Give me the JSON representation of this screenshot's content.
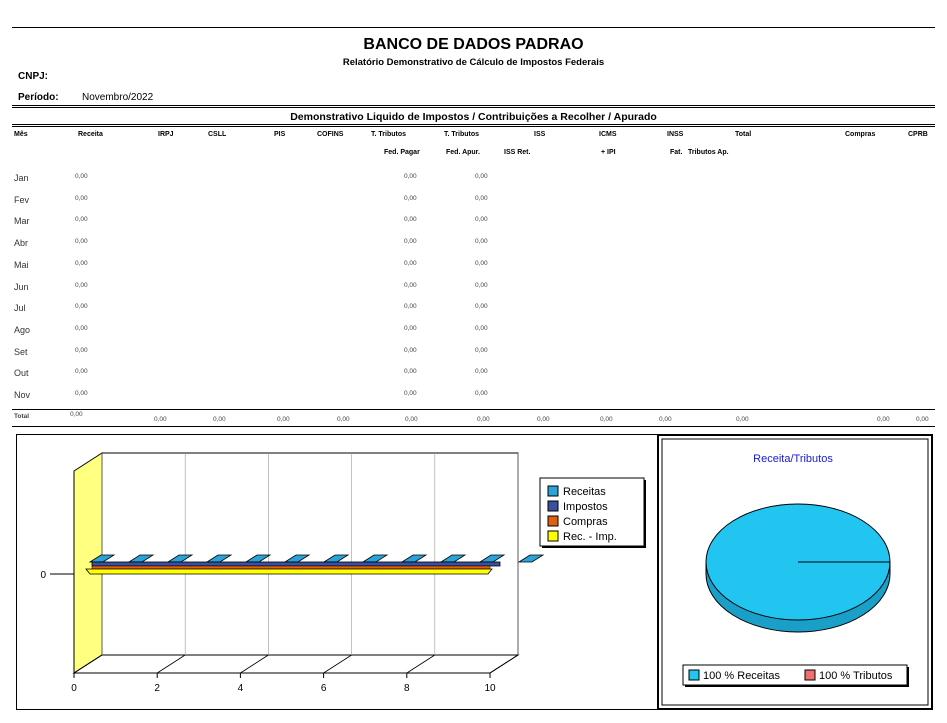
{
  "header": {
    "title": "BANCO DE DADOS PADRAO",
    "subtitle": "Relatório Demonstrativo de Cálculo de Impostos Federais",
    "cnpj_label": "CNPJ:",
    "cnpj_value": "",
    "periodo_label": "Período:",
    "periodo_value": "Novembro/2022"
  },
  "section_title": "Demonstrativo Liquido de Impostos / Contribuições a Recolher  / Apurado",
  "columns": [
    {
      "line1": "Mês",
      "line2": ""
    },
    {
      "line1": "Receita",
      "line2": ""
    },
    {
      "line1": "IRPJ",
      "line2": ""
    },
    {
      "line1": "CSLL",
      "line2": ""
    },
    {
      "line1": "PIS",
      "line2": ""
    },
    {
      "line1": "COFINS",
      "line2": ""
    },
    {
      "line1": "T. Tributos",
      "line2": "Fed. Pagar"
    },
    {
      "line1": "T. Tributos",
      "line2": "Fed. Apur."
    },
    {
      "line1": "ISS",
      "line2": "ISS Ret."
    },
    {
      "line1": "ICMS",
      "line2": "+ IPI"
    },
    {
      "line1": "INSS",
      "line2": "Fat."
    },
    {
      "line1": "Total",
      "line2": "Tributos Ap."
    },
    {
      "line1": "Compras",
      "line2": ""
    },
    {
      "line1": "CPRB",
      "line2": ""
    }
  ],
  "rows": [
    {
      "month": "Jan",
      "receita": "0,00",
      "fed_pagar": "0,00",
      "fed_apur": "0,00"
    },
    {
      "month": "Fev",
      "receita": "0,00",
      "fed_pagar": "0,00",
      "fed_apur": "0,00"
    },
    {
      "month": "Mar",
      "receita": "0,00",
      "fed_pagar": "0,00",
      "fed_apur": "0,00"
    },
    {
      "month": "Abr",
      "receita": "0,00",
      "fed_pagar": "0,00",
      "fed_apur": "0,00"
    },
    {
      "month": "Mai",
      "receita": "0,00",
      "fed_pagar": "0,00",
      "fed_apur": "0,00"
    },
    {
      "month": "Jun",
      "receita": "0,00",
      "fed_pagar": "0,00",
      "fed_apur": "0,00"
    },
    {
      "month": "Jul",
      "receita": "0,00",
      "fed_pagar": "0,00",
      "fed_apur": "0,00"
    },
    {
      "month": "Ago",
      "receita": "0,00",
      "fed_pagar": "0,00",
      "fed_apur": "0,00"
    },
    {
      "month": "Set",
      "receita": "0,00",
      "fed_pagar": "0,00",
      "fed_apur": "0,00"
    },
    {
      "month": "Out",
      "receita": "0,00",
      "fed_pagar": "0,00",
      "fed_apur": "0,00"
    },
    {
      "month": "Nov",
      "receita": "0,00",
      "fed_pagar": "0,00",
      "fed_apur": "0,00"
    }
  ],
  "totals": {
    "label": "Total",
    "values": [
      "0,00",
      "0,00",
      "0,00",
      "0,00",
      "0,00",
      "0,00",
      "0,00",
      "0,00",
      "0,00",
      "0,00",
      "0,00",
      "0,00",
      "0,00"
    ]
  },
  "chart_data": [
    {
      "type": "bar",
      "orientation": "horizontal-3d",
      "categories": [
        ""
      ],
      "series": [
        {
          "name": "Receitas",
          "values": [
            0
          ],
          "color": "#2aa3d8"
        },
        {
          "name": "Impostos",
          "values": [
            0
          ],
          "color": "#3a50a0"
        },
        {
          "name": "Compras",
          "values": [
            0
          ],
          "color": "#e06010"
        },
        {
          "name": "Rec. - Imp.",
          "values": [
            0
          ],
          "color": "#ffff00"
        }
      ],
      "y_tick_labels": [
        "0"
      ],
      "x_tick_labels": [
        "0",
        "2",
        "4",
        "6",
        "8",
        "10"
      ],
      "xlim": [
        0,
        10
      ],
      "grid": true,
      "legend": "top-right"
    },
    {
      "type": "pie",
      "title": "Receita/Tributos",
      "labels": [
        "100 % Receitas",
        "100 % Tributos"
      ],
      "values": [
        100,
        0
      ],
      "colors": [
        "#22c4f0",
        "#f07070"
      ],
      "legend": "bottom"
    }
  ]
}
